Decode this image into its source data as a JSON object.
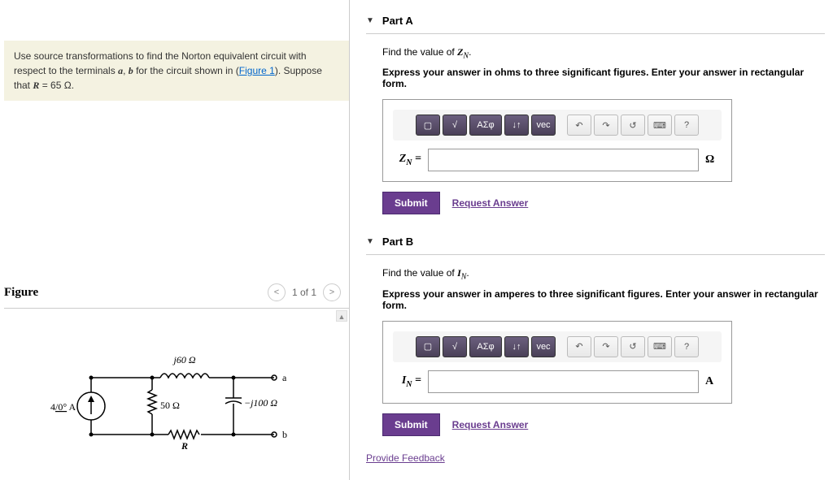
{
  "problem": {
    "text_prefix": "Use source transformations to find the Norton equivalent circuit with respect to the terminals ",
    "term_a": "a",
    "sep": ", ",
    "term_b": "b",
    "text_mid": " for the circuit shown in (",
    "figure_link": "Figure 1",
    "text_suffix": "). Suppose that ",
    "var": "R",
    "value": " = 65 Ω."
  },
  "figure": {
    "title": "Figure",
    "counter": "1 of 1",
    "circuit": {
      "source": "4/0° A",
      "r1": "50 Ω",
      "l1": "j60 Ω",
      "c1": "−j100 Ω",
      "r2": "R",
      "term_a": "a",
      "term_b": "b"
    }
  },
  "partA": {
    "title": "Part A",
    "instruction_prefix": "Find the value of ",
    "var": "Z",
    "sub": "N",
    "instruction_suffix": ".",
    "bold_instruction": "Express your answer in ohms to three significant figures. Enter your answer in rectangular form.",
    "label_var": "Z",
    "label_sub": "N",
    "label_eq": " =",
    "unit": "Ω",
    "submit": "Submit",
    "request": "Request Answer"
  },
  "partB": {
    "title": "Part B",
    "instruction_prefix": "Find the value of ",
    "var": "I",
    "sub": "N",
    "instruction_suffix": ".",
    "bold_instruction": "Express your answer in amperes to three significant figures. Enter your answer in rectangular form.",
    "label_var": "I",
    "label_sub": "N",
    "label_eq": " =",
    "unit": "A",
    "submit": "Submit",
    "request": "Request Answer"
  },
  "toolbar": {
    "templates": "▢",
    "root": "√",
    "greek": "ΑΣφ",
    "arrows": "↓↑",
    "vec": "vec",
    "undo": "↶",
    "redo": "↷",
    "reset": "↺",
    "keyboard": "⌨",
    "help": "?"
  },
  "feedback": "Provide Feedback"
}
